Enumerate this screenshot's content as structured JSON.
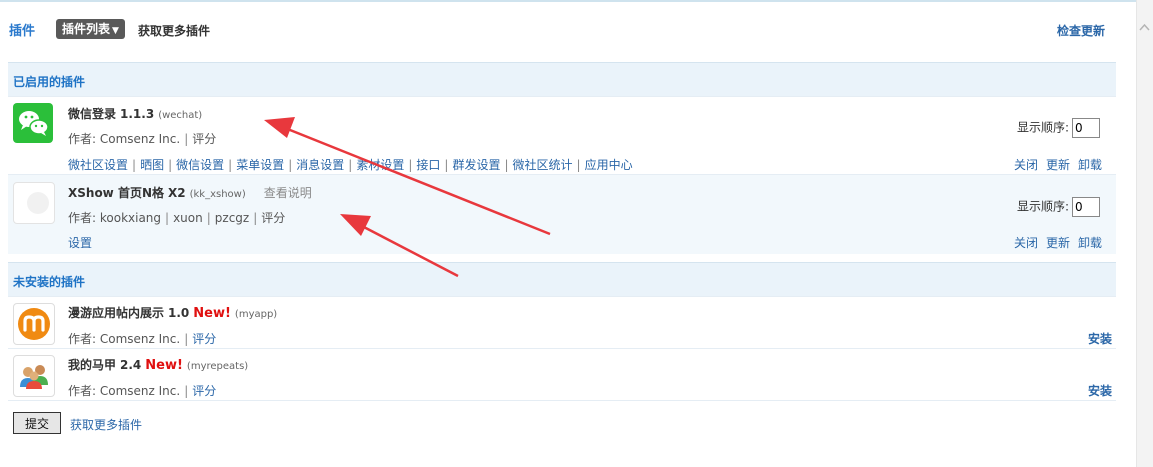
{
  "header": {
    "title": "插件",
    "tab_list": "插件列表",
    "more_plugins": "获取更多插件",
    "check_update": "检查更新"
  },
  "enabled_section": {
    "title": "已启用的插件"
  },
  "enabled_plugins": [
    {
      "name": "微信登录",
      "version": "1.1.3",
      "id": "(wechat)",
      "doc": "",
      "author_label": "作者: Comsenz Inc.",
      "rate": "评分",
      "links": [
        "微社区设置",
        "晒图",
        "微信设置",
        "菜单设置",
        "消息设置",
        "素材设置",
        "接口",
        "群发设置",
        "微社区统计",
        "应用中心"
      ],
      "order_label": "显示顺序:",
      "order_value": "0",
      "actions": [
        "关闭",
        "更新",
        "卸载"
      ]
    },
    {
      "name": "XShow 首页N格",
      "version": "X2",
      "id": "(kk_xshow)",
      "doc": "查看说明",
      "author_label": "作者: kookxiang",
      "authors_extra": [
        "xuon",
        "pzcgz"
      ],
      "rate": "评分",
      "links": [
        "设置"
      ],
      "order_label": "显示顺序:",
      "order_value": "0",
      "actions": [
        "关闭",
        "更新",
        "卸载"
      ]
    }
  ],
  "uninstalled_section": {
    "title": "未安装的插件"
  },
  "uninstalled_plugins": [
    {
      "name": "漫游应用帖内展示",
      "version": "1.0",
      "new": "New!",
      "id": "(myapp)",
      "author_label": "作者: Comsenz Inc.",
      "rate": "评分",
      "install": "安装"
    },
    {
      "name": "我的马甲",
      "version": "2.4",
      "new": "New!",
      "id": "(myrepeats)",
      "author_label": "作者: Comsenz Inc.",
      "rate": "评分",
      "install": "安装"
    }
  ],
  "footer": {
    "submit": "提交",
    "more_plugins": "获取更多插件"
  },
  "colors": {
    "link": "#2b67a8",
    "section_bg": "#eaf3fa",
    "new_badge": "#e01010",
    "arrow": "#e8383d"
  }
}
